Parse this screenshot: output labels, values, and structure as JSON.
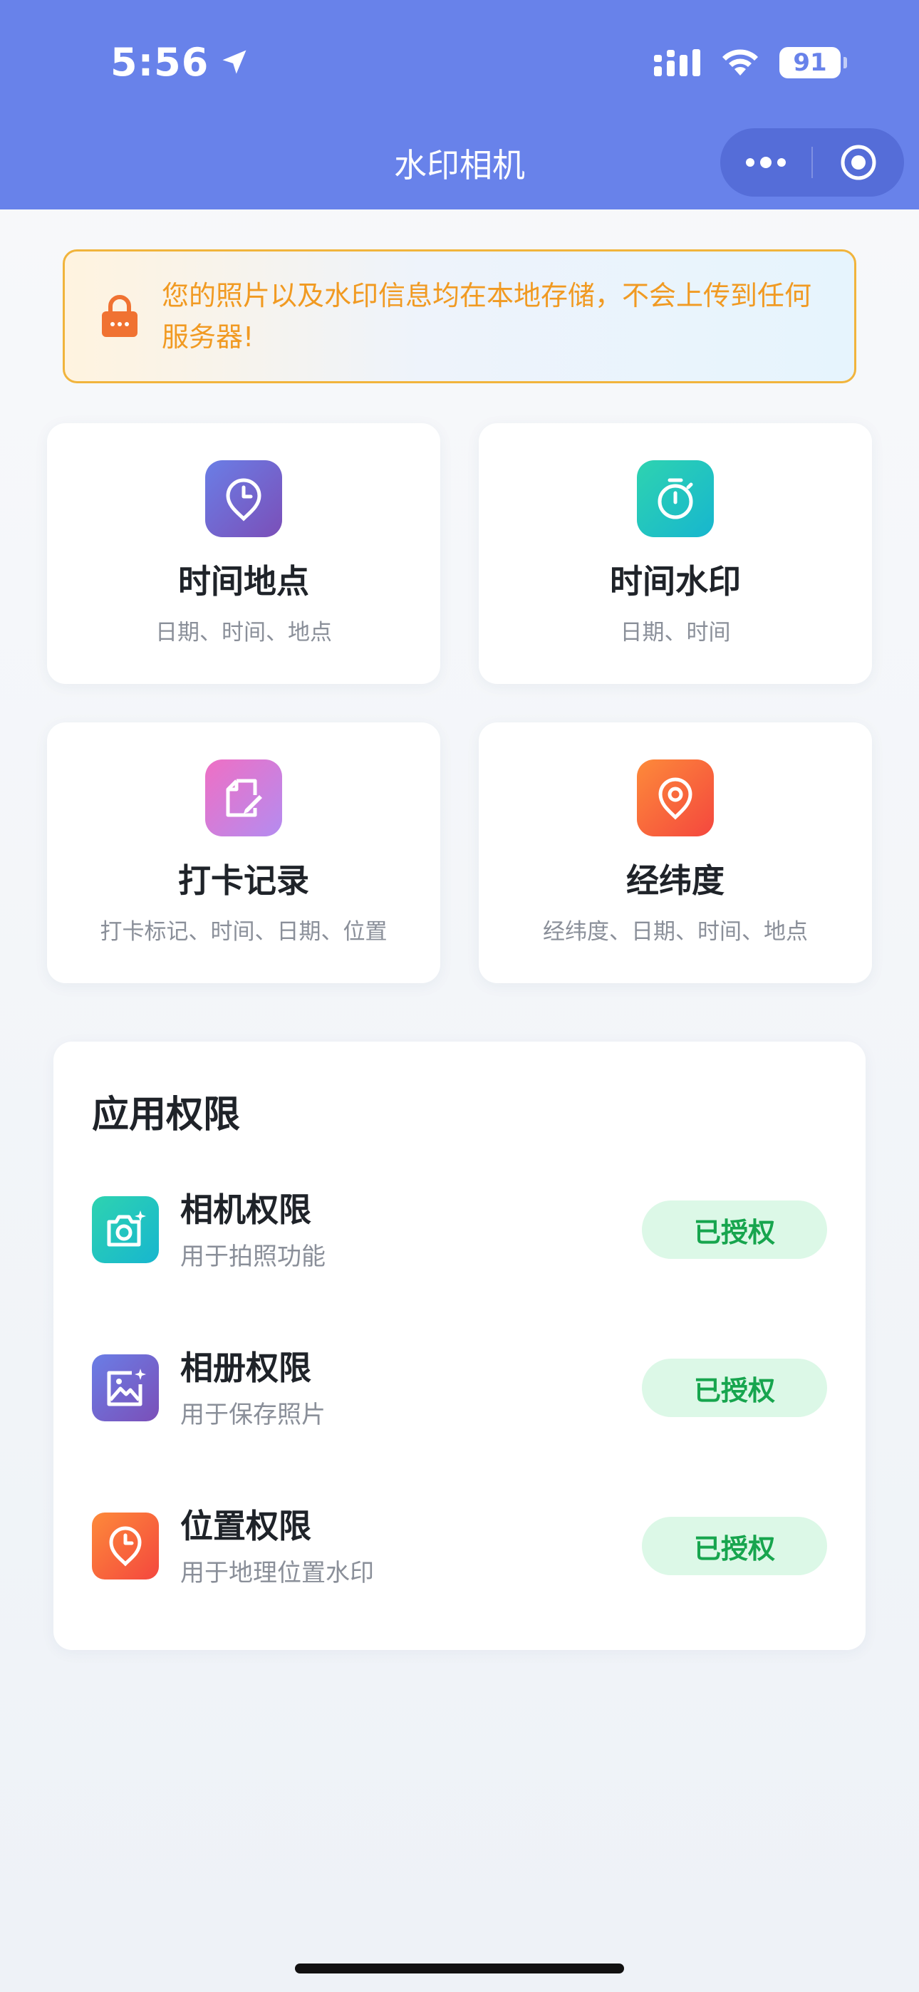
{
  "status_bar": {
    "time": "5:56",
    "battery": "91"
  },
  "nav": {
    "title": "水印相机"
  },
  "notice": {
    "text": "您的照片以及水印信息均在本地存储，不会上传到任何服务器!"
  },
  "templates": [
    {
      "title": "时间地点",
      "subtitle": "日期、时间、地点",
      "icon": "clock-pin-icon",
      "color": "#6a7ee6"
    },
    {
      "title": "时间水印",
      "subtitle": "日期、时间",
      "icon": "stopwatch-icon",
      "color": "#2ed3b0"
    },
    {
      "title": "打卡记录",
      "subtitle": "打卡标记、时间、日期、位置",
      "icon": "edit-doc-icon",
      "color": "#ef6fc4"
    },
    {
      "title": "经纬度",
      "subtitle": "经纬度、日期、时间、地点",
      "icon": "map-pin-icon",
      "color": "#fd8a3a"
    }
  ],
  "permissions": {
    "heading": "应用权限",
    "items": [
      {
        "title": "相机权限",
        "subtitle": "用于拍照功能",
        "status": "已授权",
        "icon": "camera-icon"
      },
      {
        "title": "相册权限",
        "subtitle": "用于保存照片",
        "status": "已授权",
        "icon": "gallery-icon"
      },
      {
        "title": "位置权限",
        "subtitle": "用于地理位置水印",
        "status": "已授权",
        "icon": "location-icon"
      }
    ]
  },
  "colors": {
    "header": "#6882ea",
    "notice_text": "#f19a22",
    "badge_bg": "#dcf8e7",
    "badge_text": "#17a54e"
  }
}
